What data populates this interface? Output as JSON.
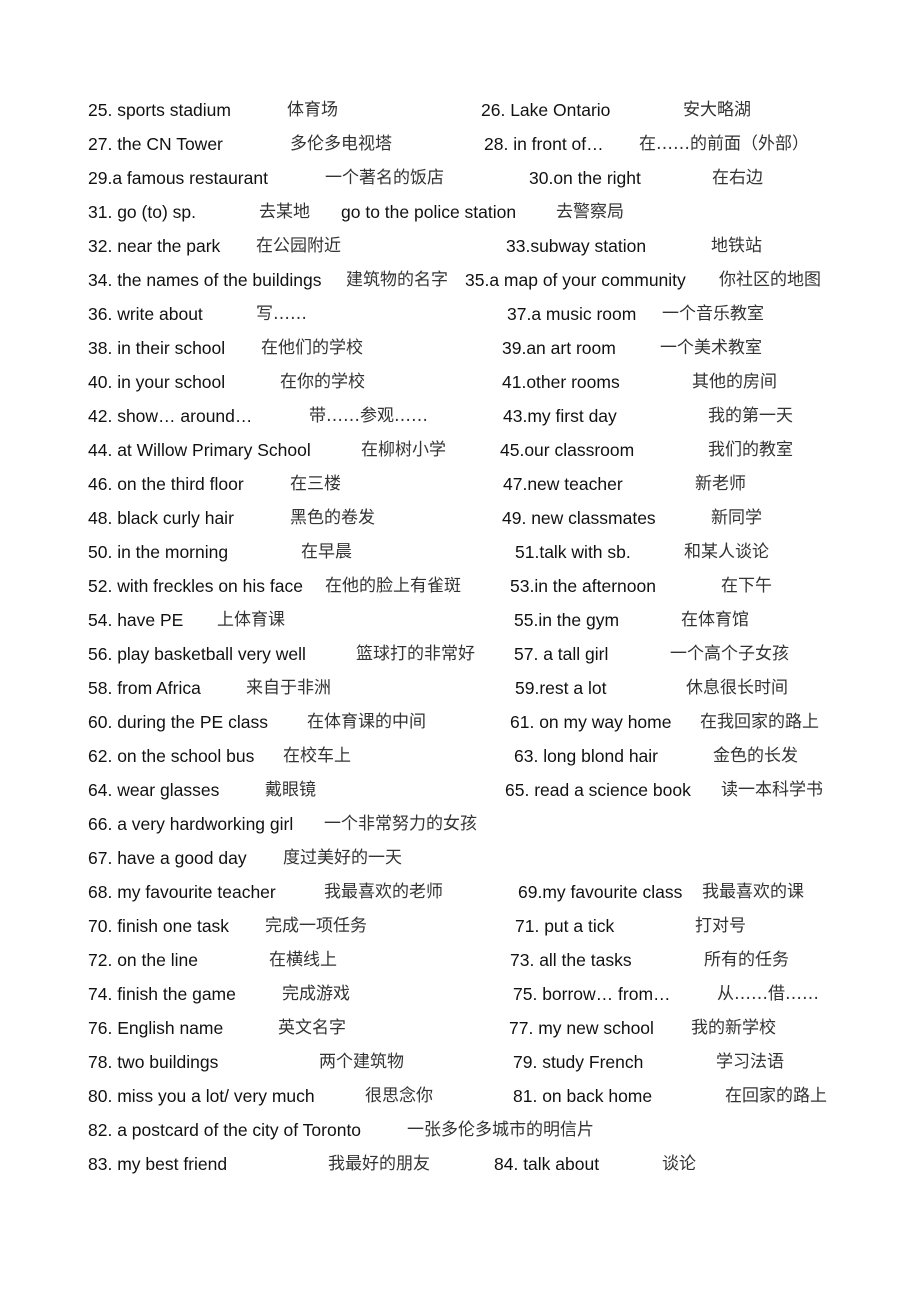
{
  "document": {
    "rows": [
      {
        "segments": [
          {
            "text": "25. sports stadium",
            "lang": "en"
          },
          {
            "text": "体育场",
            "lang": "zh"
          },
          {
            "text": "26. Lake Ontario",
            "lang": "en"
          },
          {
            "text": "安大略湖",
            "lang": "zh"
          }
        ]
      },
      {
        "segments": [
          {
            "text": "27. the CN Tower",
            "lang": "en"
          },
          {
            "text": "多伦多电视塔",
            "lang": "zh"
          },
          {
            "text": "28. in front of…",
            "lang": "en"
          },
          {
            "text": "在……的前面（外部）",
            "lang": "zh"
          }
        ]
      },
      {
        "segments": [
          {
            "text": "29.a famous restaurant",
            "lang": "en"
          },
          {
            "text": "一个著名的饭店",
            "lang": "zh"
          },
          {
            "text": "30.on the right",
            "lang": "en"
          },
          {
            "text": "在右边",
            "lang": "zh"
          }
        ]
      },
      {
        "segments": [
          {
            "text": "31. go (to) sp.",
            "lang": "en"
          },
          {
            "text": "去某地",
            "lang": "zh"
          },
          {
            "text": "go to the police station",
            "lang": "en"
          },
          {
            "text": "去警察局",
            "lang": "zh"
          }
        ]
      },
      {
        "segments": [
          {
            "text": "32. near the park",
            "lang": "en"
          },
          {
            "text": "在公园附近",
            "lang": "zh"
          },
          {
            "text": "33.subway station",
            "lang": "en"
          },
          {
            "text": "地铁站",
            "lang": "zh"
          }
        ]
      },
      {
        "segments": [
          {
            "text": "34. the names of the buildings",
            "lang": "en"
          },
          {
            "text": "建筑物的名字",
            "lang": "zh"
          },
          {
            "text": "35.a map of your community",
            "lang": "en"
          },
          {
            "text": "你社区的地图",
            "lang": "zh"
          }
        ]
      },
      {
        "segments": [
          {
            "text": "36. write about",
            "lang": "en"
          },
          {
            "text": "写……",
            "lang": "zh"
          },
          {
            "text": "37.a music room",
            "lang": "en"
          },
          {
            "text": "一个音乐教室",
            "lang": "zh"
          }
        ]
      },
      {
        "segments": [
          {
            "text": "38. in their school",
            "lang": "en"
          },
          {
            "text": "在他们的学校",
            "lang": "zh"
          },
          {
            "text": "39.an art room",
            "lang": "en"
          },
          {
            "text": "一个美术教室",
            "lang": "zh"
          }
        ]
      },
      {
        "segments": [
          {
            "text": "40. in your school",
            "lang": "en"
          },
          {
            "text": "在你的学校",
            "lang": "zh"
          },
          {
            "text": "41.other rooms",
            "lang": "en"
          },
          {
            "text": "其他的房间",
            "lang": "zh"
          }
        ]
      },
      {
        "segments": [
          {
            "text": "42. show… around…",
            "lang": "en"
          },
          {
            "text": "带……参观……",
            "lang": "zh"
          },
          {
            "text": "43.my first day",
            "lang": "en"
          },
          {
            "text": "我的第一天",
            "lang": "zh"
          }
        ]
      },
      {
        "segments": [
          {
            "text": "44. at Willow Primary School",
            "lang": "en"
          },
          {
            "text": "在柳树小学",
            "lang": "zh"
          },
          {
            "text": "45.our classroom",
            "lang": "en"
          },
          {
            "text": "我们的教室",
            "lang": "zh"
          }
        ]
      },
      {
        "segments": [
          {
            "text": "46. on the third floor",
            "lang": "en"
          },
          {
            "text": "在三楼",
            "lang": "zh"
          },
          {
            "text": "47.new teacher",
            "lang": "en"
          },
          {
            "text": "新老师",
            "lang": "zh"
          }
        ]
      },
      {
        "segments": [
          {
            "text": "48. black curly hair",
            "lang": "en"
          },
          {
            "text": "黑色的卷发",
            "lang": "zh"
          },
          {
            "text": "49. new classmates",
            "lang": "en"
          },
          {
            "text": "新同学",
            "lang": "zh"
          }
        ]
      },
      {
        "segments": [
          {
            "text": "50. in the morning",
            "lang": "en"
          },
          {
            "text": "在早晨",
            "lang": "zh"
          },
          {
            "text": "51.talk with sb.",
            "lang": "en"
          },
          {
            "text": "和某人谈论",
            "lang": "zh"
          }
        ]
      },
      {
        "segments": [
          {
            "text": "52. with freckles on his face",
            "lang": "en"
          },
          {
            "text": "在他的脸上有雀斑",
            "lang": "zh"
          },
          {
            "text": "53.in the afternoon",
            "lang": "en"
          },
          {
            "text": "在下午",
            "lang": "zh"
          }
        ]
      },
      {
        "segments": [
          {
            "text": "54. have PE",
            "lang": "en"
          },
          {
            "text": "上体育课",
            "lang": "zh"
          },
          {
            "text": "55.in the gym",
            "lang": "en"
          },
          {
            "text": "在体育馆",
            "lang": "zh"
          }
        ]
      },
      {
        "segments": [
          {
            "text": "56. play basketball very well",
            "lang": "en"
          },
          {
            "text": "篮球打的非常好",
            "lang": "zh"
          },
          {
            "text": "57. a tall girl",
            "lang": "en"
          },
          {
            "text": "一个高个子女孩",
            "lang": "zh"
          }
        ]
      },
      {
        "segments": [
          {
            "text": "58. from Africa",
            "lang": "en"
          },
          {
            "text": "来自于非洲",
            "lang": "zh"
          },
          {
            "text": "59.rest a lot",
            "lang": "en"
          },
          {
            "text": "休息很长时间",
            "lang": "zh"
          }
        ]
      },
      {
        "segments": [
          {
            "text": "60. during the PE class",
            "lang": "en"
          },
          {
            "text": "在体育课的中间",
            "lang": "zh"
          },
          {
            "text": "61. on my way home",
            "lang": "en"
          },
          {
            "text": "在我回家的路上",
            "lang": "zh"
          }
        ]
      },
      {
        "segments": [
          {
            "text": "62. on the school bus",
            "lang": "en"
          },
          {
            "text": "在校车上",
            "lang": "zh"
          },
          {
            "text": "63. long blond hair",
            "lang": "en"
          },
          {
            "text": "金色的长发",
            "lang": "zh"
          }
        ]
      },
      {
        "segments": [
          {
            "text": "64. wear glasses",
            "lang": "en"
          },
          {
            "text": "戴眼镜",
            "lang": "zh"
          },
          {
            "text": "65. read a science book",
            "lang": "en"
          },
          {
            "text": "读一本科学书",
            "lang": "zh"
          }
        ]
      },
      {
        "segments": [
          {
            "text": "66. a very hardworking girl",
            "lang": "en"
          },
          {
            "text": "一个非常努力的女孩",
            "lang": "zh"
          }
        ]
      },
      {
        "segments": [
          {
            "text": "67. have a good day",
            "lang": "en"
          },
          {
            "text": "度过美好的一天",
            "lang": "zh"
          }
        ]
      },
      {
        "segments": [
          {
            "text": "68. my favourite teacher",
            "lang": "en"
          },
          {
            "text": "我最喜欢的老师",
            "lang": "zh"
          },
          {
            "text": "69.my favourite class",
            "lang": "en"
          },
          {
            "text": "我最喜欢的课",
            "lang": "zh"
          }
        ]
      },
      {
        "segments": [
          {
            "text": "70. finish one task",
            "lang": "en"
          },
          {
            "text": "完成一项任务",
            "lang": "zh"
          },
          {
            "text": "71. put a tick",
            "lang": "en"
          },
          {
            "text": "打对号",
            "lang": "zh"
          }
        ]
      },
      {
        "segments": [
          {
            "text": "72. on the line",
            "lang": "en"
          },
          {
            "text": "在横线上",
            "lang": "zh"
          },
          {
            "text": "73. all the tasks",
            "lang": "en"
          },
          {
            "text": "所有的任务",
            "lang": "zh"
          }
        ]
      },
      {
        "segments": [
          {
            "text": "74. finish the game",
            "lang": "en"
          },
          {
            "text": "完成游戏",
            "lang": "zh"
          },
          {
            "text": "75. borrow… from…",
            "lang": "en"
          },
          {
            "text": "从……借……",
            "lang": "zh"
          }
        ]
      },
      {
        "segments": [
          {
            "text": "76. English name",
            "lang": "en"
          },
          {
            "text": "英文名字",
            "lang": "zh"
          },
          {
            "text": "77. my new school",
            "lang": "en"
          },
          {
            "text": "我的新学校",
            "lang": "zh"
          }
        ]
      },
      {
        "segments": [
          {
            "text": "78. two buildings",
            "lang": "en"
          },
          {
            "text": "两个建筑物",
            "lang": "zh"
          },
          {
            "text": "79. study French",
            "lang": "en"
          },
          {
            "text": "学习法语",
            "lang": "zh"
          }
        ]
      },
      {
        "segments": [
          {
            "text": "80. miss you a lot/ very much",
            "lang": "en"
          },
          {
            "text": "很思念你",
            "lang": "zh"
          },
          {
            "text": "81. on back home",
            "lang": "en"
          },
          {
            "text": "在回家的路上",
            "lang": "zh"
          }
        ]
      },
      {
        "segments": [
          {
            "text": "82. a postcard of the city of Toronto",
            "lang": "en"
          },
          {
            "text": "一张多伦多城市的明信片",
            "lang": "zh"
          }
        ]
      },
      {
        "segments": [
          {
            "text": "83. my best friend",
            "lang": "en"
          },
          {
            "text": "我最好的朋友",
            "lang": "zh"
          },
          {
            "text": "84. talk about",
            "lang": "en"
          },
          {
            "text": "谈论",
            "lang": "zh"
          }
        ]
      }
    ]
  }
}
